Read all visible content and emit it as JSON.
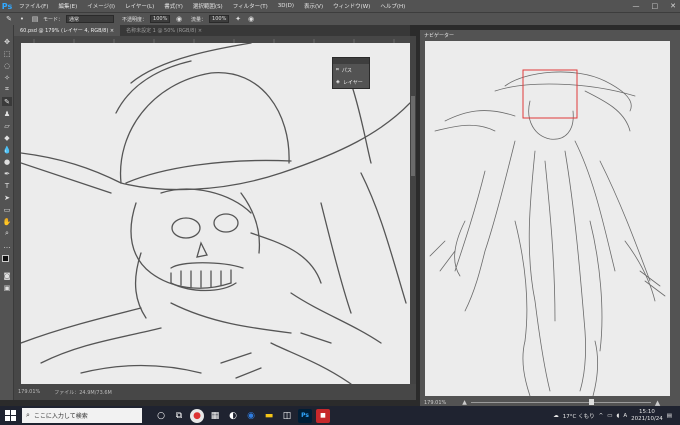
{
  "app": {
    "logo": "Ps",
    "menu": [
      "ファイル(F)",
      "編集(E)",
      "イメージ(I)",
      "レイヤー(L)",
      "書式(Y)",
      "選択範囲(S)",
      "フィルター(T)",
      "3D(D)",
      "表示(V)",
      "ウィンドウ(W)",
      "ヘルプ(H)"
    ],
    "window_controls": {
      "minimize": "—",
      "maximize": "□",
      "close": "✕"
    }
  },
  "options": {
    "mode_label": "モード：",
    "mode_value": "通常",
    "opacity_label": "不透明度：",
    "opacity_value": "100%",
    "flow_label": "流量：",
    "flow_value": "100%"
  },
  "tabs": [
    {
      "label": "60.psd @ 179% (レイヤー 4, RGB/8) ×"
    },
    {
      "label": "名称未設定 1 @ 50% (RGB/8) ×"
    }
  ],
  "floating_panel": {
    "paths_label": "パス",
    "layers_label": "レイヤー"
  },
  "status": {
    "zoom": "179.01%",
    "file_info": "ファイル：24.9M/73.6M"
  },
  "navigator": {
    "title": "ナビゲーター",
    "zoom": "179.01%"
  },
  "taskbar": {
    "search_placeholder": "ここに入力して検索",
    "weather": "17°C くもり",
    "ime": "A",
    "time": "15:10",
    "date": "2021/10/24"
  },
  "icons": {
    "windows": "windows-icon",
    "search": "search-icon",
    "task_view": "task-view-icon",
    "chrome": "chrome-icon",
    "photoshop": "photoshop-icon"
  },
  "colors": {
    "ui_panel": "#535353",
    "canvas": "#ececec",
    "nav_frame": "#e03a3a",
    "ps_blue": "#31a8ff",
    "taskbar": "#1f2330"
  }
}
